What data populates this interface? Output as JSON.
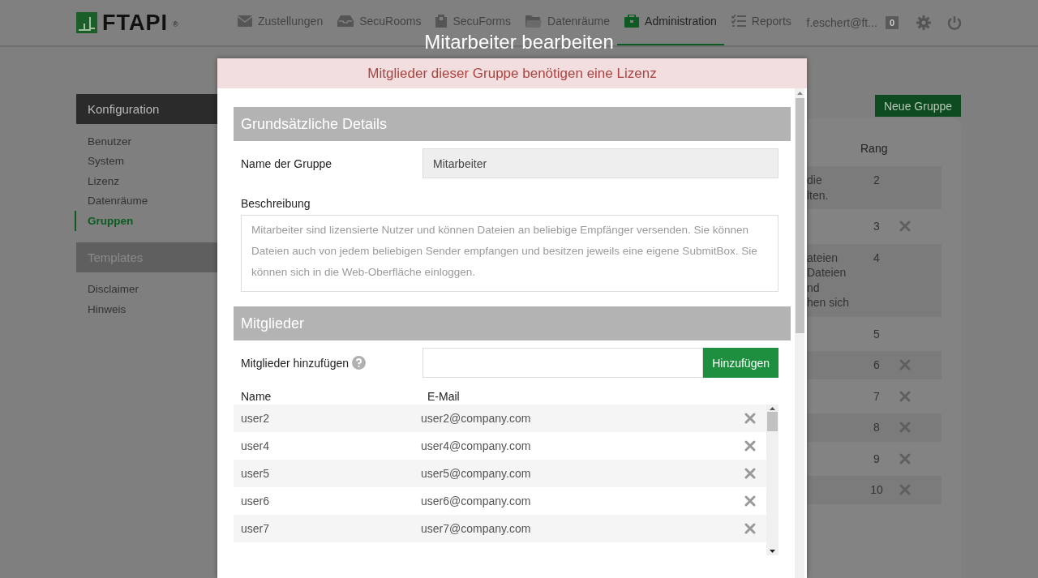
{
  "header": {
    "logo": "FTAPI",
    "logo_mark": "®",
    "nav": [
      {
        "label": "Zustellungen",
        "selected": false
      },
      {
        "label": "SecuRooms",
        "selected": false
      },
      {
        "label": "SecuForms",
        "selected": false
      },
      {
        "label": "Datenräume",
        "selected": false
      },
      {
        "label": "Administration",
        "selected": true
      },
      {
        "label": "Reports",
        "selected": false
      }
    ],
    "user": "f.eschert@ft...",
    "badge": "0"
  },
  "sidebar": {
    "sections": [
      {
        "title": "Konfiguration",
        "active": true,
        "items": [
          {
            "label": "Benutzer",
            "selected": false
          },
          {
            "label": "System",
            "selected": false
          },
          {
            "label": "Lizenz",
            "selected": false
          },
          {
            "label": "Datenräume",
            "selected": false
          },
          {
            "label": "Gruppen",
            "selected": true
          }
        ]
      },
      {
        "title": "Templates",
        "active": false,
        "items": [
          {
            "label": "Disclaimer",
            "selected": false
          },
          {
            "label": "Hinweis",
            "selected": false
          }
        ]
      }
    ]
  },
  "groups": {
    "new_button": "Neue Gruppe",
    "rank_header": "Rang",
    "rows": [
      {
        "lines": [
          "die",
          "lten."
        ],
        "rank": "2",
        "deletable": false
      },
      {
        "lines": [],
        "rank": "3",
        "deletable": true
      },
      {
        "lines": [
          "ateien",
          "Dateien",
          "nd",
          "hen sich"
        ],
        "rank": "4",
        "deletable": false
      },
      {
        "lines": [],
        "rank": "5",
        "deletable": false
      },
      {
        "lines": [],
        "rank": "6",
        "deletable": true
      },
      {
        "lines": [],
        "rank": "7",
        "deletable": true
      },
      {
        "lines": [],
        "rank": "8",
        "deletable": true
      },
      {
        "lines": [],
        "rank": "9",
        "deletable": true
      },
      {
        "lines": [],
        "rank": "10",
        "deletable": true
      }
    ]
  },
  "dialog": {
    "title": "Mitarbeiter bearbeiten",
    "alert": "Mitglieder dieser Gruppe benötigen eine Lizenz",
    "details": {
      "heading": "Grundsätzliche Details",
      "name_label": "Name der Gruppe",
      "name_value": "Mitarbeiter",
      "description_label": "Beschreibung",
      "description": "Mitarbeiter sind lizensierte Nutzer und können Dateien an beliebige Empfänger versenden. Sie können Dateien auch von jedem beliebigen Sender empfangen und besitzen jeweils eine eigene SubmitBox. Sie können sich in die Web-Oberfläche einloggen."
    },
    "members": {
      "heading": "Mitglieder",
      "add_label": "Mitglieder hinzufügen",
      "add_button": "Hinzufügen",
      "columns": [
        "Name",
        "E-Mail"
      ],
      "rows": [
        {
          "name": "user2",
          "email": "user2@company.com"
        },
        {
          "name": "user4",
          "email": "user4@company.com"
        },
        {
          "name": "user5",
          "email": "user5@company.com"
        },
        {
          "name": "user6",
          "email": "user6@company.com"
        },
        {
          "name": "user7",
          "email": "user7@company.com"
        }
      ]
    }
  }
}
